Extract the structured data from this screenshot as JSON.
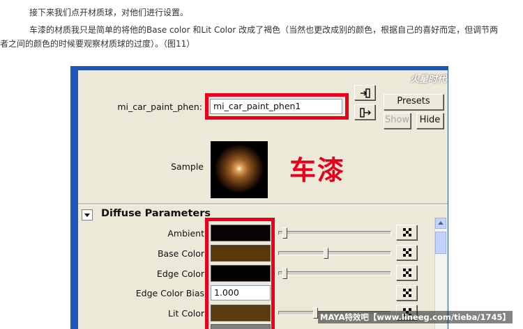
{
  "article": {
    "para1": "接下来我们点开材质球，对他们进行设置。",
    "para2_line1": "车漆的材质我只是简单的将他的Base color 和Lit Color 改成了褐色（当然也更改成别的颜色，根据自己的喜好而定，但调节两",
    "para2_line2": "者之间的颜色的时候要观察材质球的过度）。（图11）"
  },
  "editor": {
    "logo_watermark": "火星时代",
    "shader_label": "mi_car_paint_phen:",
    "shader_name": "mi_car_paint_phen1",
    "buttons": {
      "presets": "Presets",
      "show": "Show",
      "hide": "Hide"
    },
    "sample_label": "Sample",
    "annotation": "车漆",
    "section": {
      "title": "Diffuse Parameters"
    },
    "attributes": [
      {
        "label": "Ambient",
        "color": "#050402",
        "slider_fraction": 0.03
      },
      {
        "label": "Base Color",
        "color": "#5a380c",
        "slider_fraction": 0.42
      },
      {
        "label": "Edge Color",
        "color": "#040302",
        "slider_fraction": 0.03
      },
      {
        "label": "Edge Color Bias",
        "value": "1.000"
      },
      {
        "label": "Lit Color",
        "color": "#5a3a0f",
        "slider_fraction": 0.32
      }
    ]
  },
  "site_watermark": "MAYA特效吧【www.lineeg.com/tieba/1745】",
  "colors": {
    "highlight_red": "#e8001c",
    "panel_bg": "#ece9d8",
    "window_blue": "#1e56b8"
  }
}
